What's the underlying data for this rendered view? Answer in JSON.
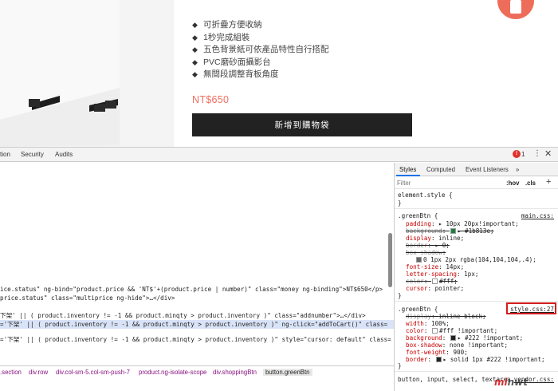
{
  "product": {
    "features": [
      "可折疊方便收納",
      "1秒完成組裝",
      "五色背景紙可依產品特性自行搭配",
      "PVC磨砂面攝影台",
      "無間段調整背板角度"
    ],
    "feature_bullet": "◆",
    "price": "NT$650",
    "add_to_cart_label": "新增到購物袋",
    "accent_color": "#f06e5e"
  },
  "devtools": {
    "tabs": [
      "tion",
      "Security",
      "Audits"
    ],
    "error_count": "1",
    "more_icon": "⋮",
    "close_icon": "✕",
    "elements": {
      "lines": [
        "ice.status\" ng-bind=\"product.price && 'NT$'+(product.price | number)\" class=\"money ng-binding\">NT$650</p>",
        "price.status\" class=\"multiprice ng-hide\">…</div>",
        "下架' || ( product.inventory != -1 && product.minqty > product.inventory )\" class=\"addnumber\">…</div>",
        "='下架' || ( product.inventory != -1 && product.minqty > product.inventory )\" ng-click=\"addToCart()\" class=",
        "='下架' || ( product.inventory != -1 && product.minqty > product.inventory )\" style=\"cursor: default\" class="
      ]
    },
    "breadcrumb": [
      ".section",
      "div.row",
      "div.col-sm-5.col-sm-push-7",
      "product.ng-isolate-scope",
      "div.shoppingBtn",
      "button.greenBtn"
    ],
    "styles": {
      "tabs": [
        "Styles",
        "Computed",
        "Event Listeners",
        "»"
      ],
      "filter_placeholder": "Filter",
      "hov_label": ":hov",
      "cls_label": ".cls",
      "add_label": "+",
      "element_style": {
        "selector": "element.style {",
        "close": "}"
      },
      "rule1": {
        "selector": ".greenBtn {",
        "source": "main.css:",
        "close": "}",
        "properties": [
          {
            "name": "padding",
            "value": "▸ 10px 20px!important;",
            "struck": false
          },
          {
            "name": "background",
            "value": "▸ #1b813e;",
            "struck": true,
            "swatch": "#1b813e"
          },
          {
            "name": "display",
            "value": "inline;",
            "struck": false
          },
          {
            "name": "border",
            "value": "▸ 0;",
            "struck": true
          },
          {
            "name": "box-shadow",
            "value": "",
            "struck": true
          },
          {
            "name": "",
            "value": "0 1px 2px rgba(104,104,104,.4);",
            "struck": false,
            "swatch": "#686868",
            "indent": true
          },
          {
            "name": "font-size",
            "value": "14px;",
            "struck": false
          },
          {
            "name": "letter-spacing",
            "value": "1px;",
            "struck": false
          },
          {
            "name": "color",
            "value": "#fff;",
            "struck": true,
            "swatch": "#ffffff"
          },
          {
            "name": "cursor",
            "value": "pointer;",
            "struck": false
          }
        ]
      },
      "rule2": {
        "selector": ".greenBtn {",
        "source": "style.css:27",
        "close": "}",
        "properties": [
          {
            "name": "display",
            "value": "inline-block;",
            "struck": true
          },
          {
            "name": "width",
            "value": "100%;",
            "struck": false
          },
          {
            "name": "color",
            "value": "#fff !important;",
            "struck": false,
            "swatch": "#ffffff"
          },
          {
            "name": "background",
            "value": "▸ #222 !important;",
            "struck": false,
            "swatch": "#222222"
          },
          {
            "name": "box-shadow",
            "value": "none !important;",
            "struck": false
          },
          {
            "name": "font-weight",
            "value": "900;",
            "struck": false
          },
          {
            "name": "border",
            "value": "▸ solid 1px #222 !important;",
            "struck": false,
            "swatch": "#222222"
          }
        ]
      },
      "rule3": {
        "selector": "button, input, select, textarea",
        "source": "vendor.css:"
      }
    }
  },
  "watermark": {
    "prefix": "m",
    "accent": "i",
    "suffix": "nwt"
  }
}
